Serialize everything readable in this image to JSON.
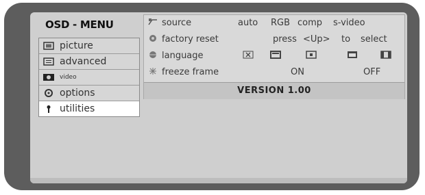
{
  "osd": {
    "title": "OSD - MENU",
    "menu_items": [
      {
        "label": "picture",
        "icon": "picture-icon"
      },
      {
        "label": "advanced",
        "icon": "advanced-icon"
      },
      {
        "label": "video",
        "icon": "video-icon"
      },
      {
        "label": "options",
        "icon": "options-icon"
      },
      {
        "label": "utilities",
        "icon": "utilities-icon"
      }
    ],
    "active_item": "utilities"
  },
  "utilities": {
    "source": {
      "label": "source",
      "options": [
        "auto",
        "RGB",
        "comp",
        "s-video"
      ]
    },
    "factory_reset": {
      "label": "factory reset",
      "hint": [
        "press",
        "<Up>",
        "to",
        "select"
      ]
    },
    "language": {
      "label": "language",
      "flag_icons": [
        "language-x-icon",
        "language-box-1-icon",
        "language-box-2-icon",
        "language-box-3-icon",
        "language-box-4-icon"
      ]
    },
    "freeze_frame": {
      "label": "freeze frame",
      "on": "ON",
      "off": "OFF"
    },
    "version": "VERSION 1.00"
  },
  "colors": {
    "frame": "#5d5d5d",
    "screen": "#cfcfcf",
    "panel": "#d9d9d9",
    "highlight": "#ffffff"
  }
}
